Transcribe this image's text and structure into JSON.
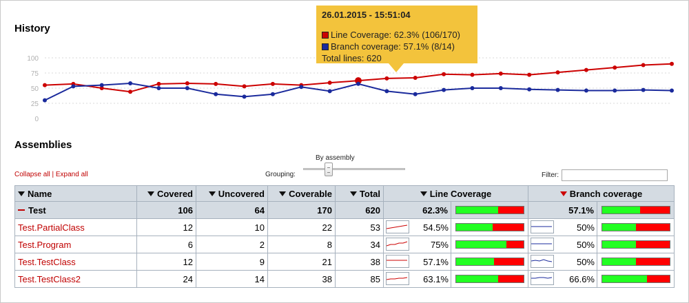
{
  "history": {
    "title": "History",
    "y_ticks": [
      "0",
      "25",
      "50",
      "75",
      "100"
    ],
    "chart_data": {
      "type": "line",
      "ylim": [
        0,
        100
      ],
      "x": [
        1,
        2,
        3,
        4,
        5,
        6,
        7,
        8,
        9,
        10,
        11,
        12,
        13,
        14,
        15,
        16,
        17,
        18,
        19,
        20,
        21,
        22,
        23
      ],
      "series": [
        {
          "name": "Line Coverage",
          "color": "#cc0000",
          "values": [
            55,
            57,
            50,
            44,
            57,
            58,
            57,
            53,
            57,
            55,
            59,
            62.3,
            66,
            67,
            73,
            72,
            74,
            72,
            76,
            80,
            84,
            88,
            90
          ]
        },
        {
          "name": "Branch coverage",
          "color": "#1a2a9c",
          "values": [
            30,
            53,
            55,
            58,
            50,
            50,
            40,
            36,
            40,
            52,
            45,
            57.1,
            45,
            40,
            47,
            50,
            50,
            48,
            47,
            46,
            46,
            47,
            46
          ]
        }
      ],
      "highlight_index": 11
    }
  },
  "tooltip": {
    "date": "26.01.2015 - 15:51:04",
    "line": "Line Coverage: 62.3% (106/170)",
    "branch": "Branch coverage: 57.1% (8/14)",
    "total": "Total lines: 620",
    "line_color": "#cc0000",
    "branch_color": "#1a2a9c"
  },
  "assemblies": {
    "title": "Assemblies",
    "collapse_all": "Collapse all",
    "separator": "|",
    "expand_all": "Expand all",
    "grouping_label": "Grouping:",
    "grouping_value": "By assembly",
    "filter_label": "Filter:",
    "filter_value": ""
  },
  "table": {
    "headers": {
      "name": "Name",
      "covered": "Covered",
      "uncovered": "Uncovered",
      "coverable": "Coverable",
      "total": "Total",
      "line_coverage": "Line Coverage",
      "branch_coverage": "Branch coverage"
    },
    "total_row": {
      "name": "Test",
      "covered": "106",
      "uncovered": "64",
      "coverable": "170",
      "total": "620",
      "line_pct": "62.3%",
      "line_fraction": 0.623,
      "branch_pct": "57.1%",
      "branch_fraction": 0.571
    },
    "rows": [
      {
        "name": "Test.PartialClass",
        "covered": "12",
        "uncovered": "10",
        "coverable": "22",
        "total": "53",
        "line_pct": "54.5%",
        "line_fraction": 0.545,
        "branch_pct": "50%",
        "branch_fraction": 0.5
      },
      {
        "name": "Test.Program",
        "covered": "6",
        "uncovered": "2",
        "coverable": "8",
        "total": "34",
        "line_pct": "75%",
        "line_fraction": 0.75,
        "branch_pct": "50%",
        "branch_fraction": 0.5
      },
      {
        "name": "Test.TestClass",
        "covered": "12",
        "uncovered": "9",
        "coverable": "21",
        "total": "38",
        "line_pct": "57.1%",
        "line_fraction": 0.571,
        "branch_pct": "50%",
        "branch_fraction": 0.5
      },
      {
        "name": "Test.TestClass2",
        "covered": "24",
        "uncovered": "14",
        "coverable": "38",
        "total": "85",
        "line_pct": "63.1%",
        "line_fraction": 0.631,
        "branch_pct": "66.6%",
        "branch_fraction": 0.666
      }
    ]
  },
  "colors": {
    "covered_bar": "#22ff22",
    "uncovered_bar": "#ff0000",
    "link": "#c00000",
    "header_bg": "#d4dbe2",
    "tooltip_bg": "#f3c33c"
  }
}
